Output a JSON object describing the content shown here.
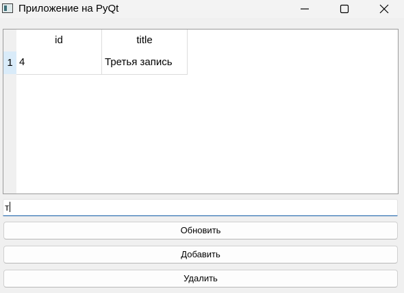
{
  "window": {
    "title": "Приложение на PyQt",
    "icons": {
      "app": "app-window-icon",
      "minimize": "minimize-icon",
      "maximize": "maximize-icon",
      "close": "close-icon"
    }
  },
  "table": {
    "columns": [
      "id",
      "title"
    ],
    "rows": [
      {
        "header": "1",
        "id": "4",
        "title": "Третья запись"
      }
    ]
  },
  "input": {
    "value": "т"
  },
  "buttons": {
    "update": "Обновить",
    "add": "Добавить",
    "delete": "Удалить"
  },
  "colors": {
    "window_bg": "#f0f0f0",
    "selected_row_header": "#d9ebf9",
    "input_focus_border": "#0f5aa6"
  }
}
